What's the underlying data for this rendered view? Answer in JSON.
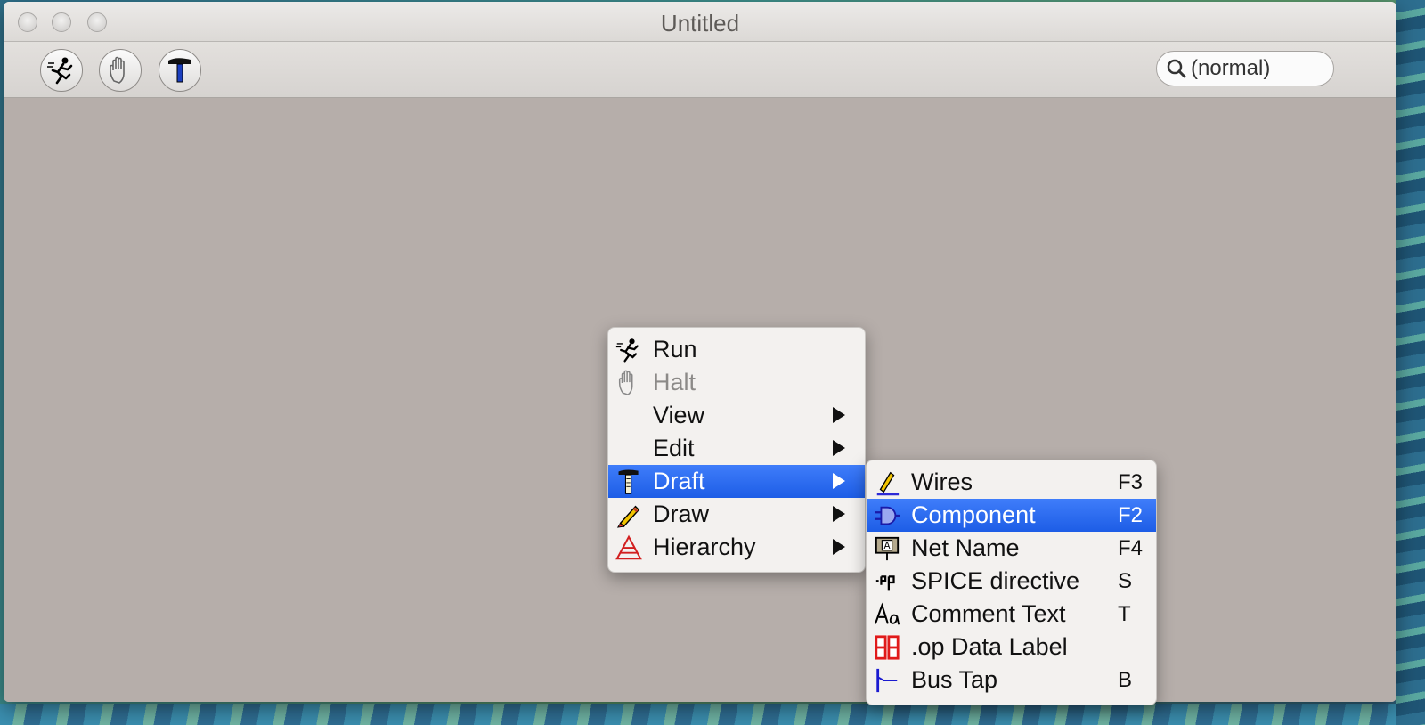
{
  "window": {
    "title": "Untitled"
  },
  "toolbar": {
    "buttons": [
      {
        "icon": "run-icon"
      },
      {
        "icon": "halt-icon"
      },
      {
        "icon": "hammer-icon"
      }
    ],
    "search_value": "(normal)"
  },
  "context_menu": {
    "items": [
      {
        "label": "Run",
        "icon": "run-icon",
        "state": "normal"
      },
      {
        "label": "Halt",
        "icon": "hand-icon",
        "state": "disabled"
      },
      {
        "label": "View",
        "submenu": true
      },
      {
        "label": "Edit",
        "submenu": true
      },
      {
        "label": "Draft",
        "icon": "hammer-icon",
        "submenu": true,
        "state": "selected"
      },
      {
        "label": "Draw",
        "icon": "pencil-icon",
        "submenu": true
      },
      {
        "label": "Hierarchy",
        "icon": "hierarchy-icon",
        "submenu": true
      }
    ]
  },
  "draft_submenu": {
    "items": [
      {
        "label": "Wires",
        "shortcut": "F3",
        "icon": "wire-pen-icon"
      },
      {
        "label": "Component",
        "shortcut": "F2",
        "icon": "component-icon",
        "state": "selected"
      },
      {
        "label": "Net Name",
        "shortcut": "F4",
        "icon": "net-name-icon"
      },
      {
        "label": "SPICE directive",
        "shortcut": "S",
        "icon": "spice-directive-icon"
      },
      {
        "label": "Comment Text",
        "shortcut": "T",
        "icon": "comment-text-icon"
      },
      {
        "label": ".op Data Label",
        "shortcut": "",
        "icon": "op-data-label-icon"
      },
      {
        "label": "Bus Tap",
        "shortcut": "B",
        "icon": "bus-tap-icon"
      }
    ]
  },
  "colors": {
    "selection": "#1d5de6",
    "canvas": "#b6aeaa",
    "menu_bg": "#f3f1ef"
  }
}
